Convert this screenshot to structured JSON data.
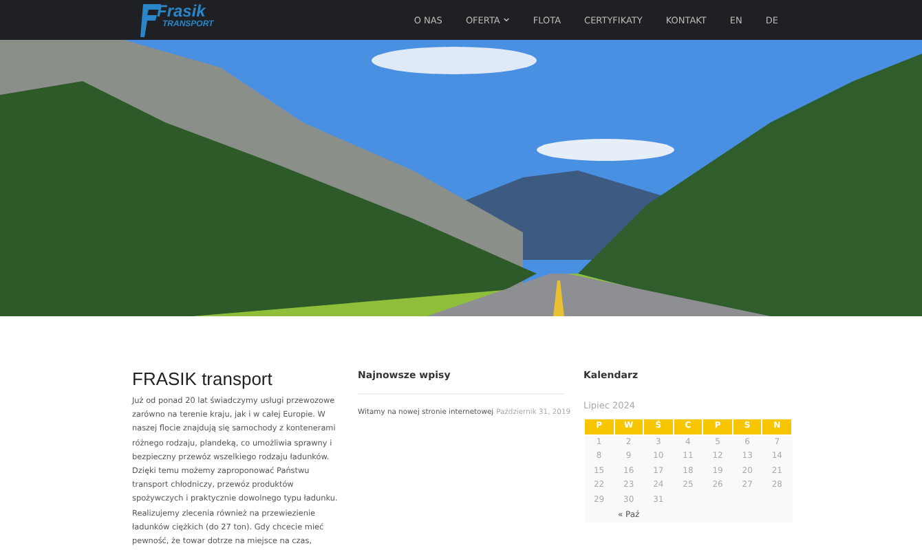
{
  "header": {
    "logo": {
      "name": "Frasik",
      "tagline": "TRANSPORT"
    },
    "nav": [
      {
        "label": "O NAS",
        "kind": "link"
      },
      {
        "label": "OFERTA",
        "kind": "dropdown"
      },
      {
        "label": "FLOTA",
        "kind": "link"
      },
      {
        "label": "CERTYFIKATY",
        "kind": "link"
      },
      {
        "label": "KONTAKT",
        "kind": "link"
      },
      {
        "label": "EN",
        "kind": "link"
      },
      {
        "label": "DE",
        "kind": "link"
      }
    ]
  },
  "about": {
    "title": "FRASIK transport",
    "text": "Już od ponad 20 lat świadczymy usługi przewozowe zarówno na terenie kraju, jak i w całej Europie. W naszej flocie znajdują się samochody z kontenerami różnego rodzaju, plandeką, co umożliwia sprawny i bezpieczny przewóz wszelkiego rodzaju ładunków. Dzięki temu możemy zaproponować Państwu transport chłodniczy, przewóz produktów spożywczych i praktycznie dowolnego typu ładunku. Realizujemy zlecenia również na przewiezienie ładunków ciężkich (do 27 ton). Gdy chcecie mieć pewność, że towar dotrze na miejsce na czas,"
  },
  "recent_posts": {
    "title": "Najnowsze wpisy",
    "posts": [
      {
        "title": "Witamy na nowej stronie internetowej",
        "date": "Październik 31, 2019"
      }
    ]
  },
  "calendar": {
    "title": "Kalendarz",
    "caption": "Lipiec 2024",
    "weekdays": [
      "P",
      "W",
      "Ś",
      "C",
      "P",
      "S",
      "N"
    ],
    "weeks": [
      [
        "1",
        "2",
        "3",
        "4",
        "5",
        "6",
        "7"
      ],
      [
        "8",
        "9",
        "10",
        "11",
        "12",
        "13",
        "14"
      ],
      [
        "15",
        "16",
        "17",
        "18",
        "19",
        "20",
        "21"
      ],
      [
        "22",
        "23",
        "24",
        "25",
        "26",
        "27",
        "28"
      ],
      [
        "29",
        "30",
        "31"
      ]
    ],
    "prev": "« Paź"
  }
}
